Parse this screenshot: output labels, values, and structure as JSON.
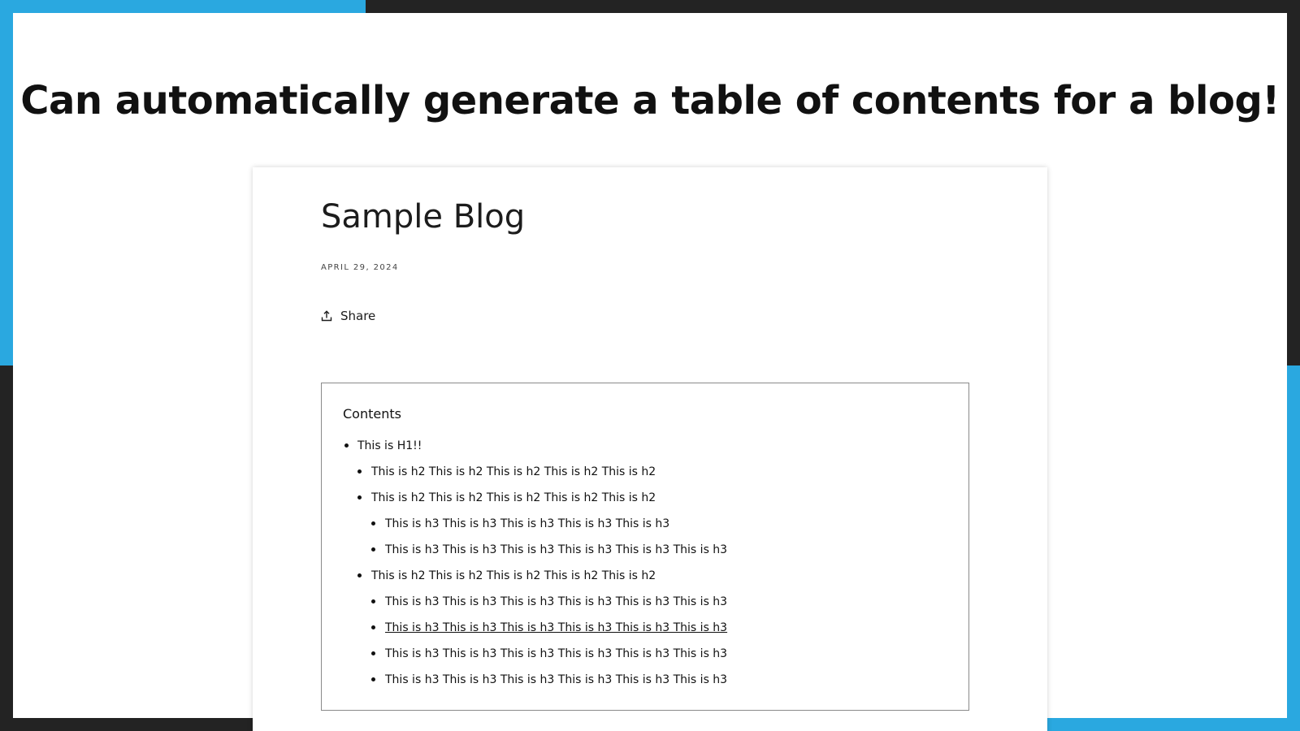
{
  "headline": "Can automatically generate a table of contents for a blog!",
  "colors": {
    "accent_blue": "#2aa8e0",
    "frame_dark": "#232323",
    "text": "#111111"
  },
  "blog": {
    "title": "Sample Blog",
    "date": "APRIL 29, 2024",
    "share_label": "Share",
    "share_icon": "share-upload-icon"
  },
  "toc": {
    "heading": "Contents",
    "items": [
      {
        "level": 1,
        "text": "This is H1!!"
      },
      {
        "level": 2,
        "text": "This is h2 This is h2 This is h2 This is h2 This is h2"
      },
      {
        "level": 2,
        "text": "This is h2 This is h2 This is h2 This is h2 This is h2"
      },
      {
        "level": 3,
        "text": "This is h3 This is h3 This is h3 This is h3 This is h3"
      },
      {
        "level": 3,
        "text": "This is h3 This is h3 This is h3 This is h3 This is h3 This is h3"
      },
      {
        "level": 2,
        "text": "This is h2 This is h2 This is h2 This is h2 This is h2"
      },
      {
        "level": 3,
        "text": "This is h3 This is h3 This is h3 This is h3 This is h3 This is h3"
      },
      {
        "level": 3,
        "text": "This is h3 This is h3 This is h3 This is h3 This is h3 This is h3",
        "hovered": true
      },
      {
        "level": 3,
        "text": "This is h3 This is h3 This is h3 This is h3 This is h3 This is h3"
      },
      {
        "level": 3,
        "text": "This is h3 This is h3 This is h3 This is h3 This is h3 This is h3"
      }
    ]
  }
}
